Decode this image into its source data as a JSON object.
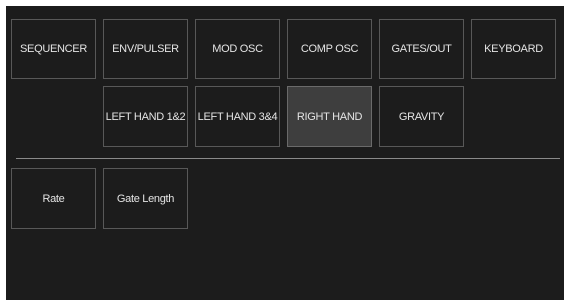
{
  "mode_tabs": [
    {
      "label": "SEQUENCER"
    },
    {
      "label": "ENV/PULSER"
    },
    {
      "label": "MOD OSC"
    },
    {
      "label": "COMP OSC"
    },
    {
      "label": "GATES/OUT"
    },
    {
      "label": "KEYBOARD"
    }
  ],
  "sub_tabs": [
    {
      "label": "LEFT HAND 1&2"
    },
    {
      "label": "LEFT HAND 3&4"
    },
    {
      "label": "RIGHT HAND",
      "active": true
    },
    {
      "label": "GRAVITY"
    }
  ],
  "parameters": [
    {
      "label": "Rate"
    },
    {
      "label": "Gate Length"
    }
  ],
  "colors": {
    "background": "#1c1c1c",
    "border": "#585858",
    "active_background": "#3e3e3e",
    "text": "#e4e4e4",
    "divider": "#8a8a8a"
  }
}
